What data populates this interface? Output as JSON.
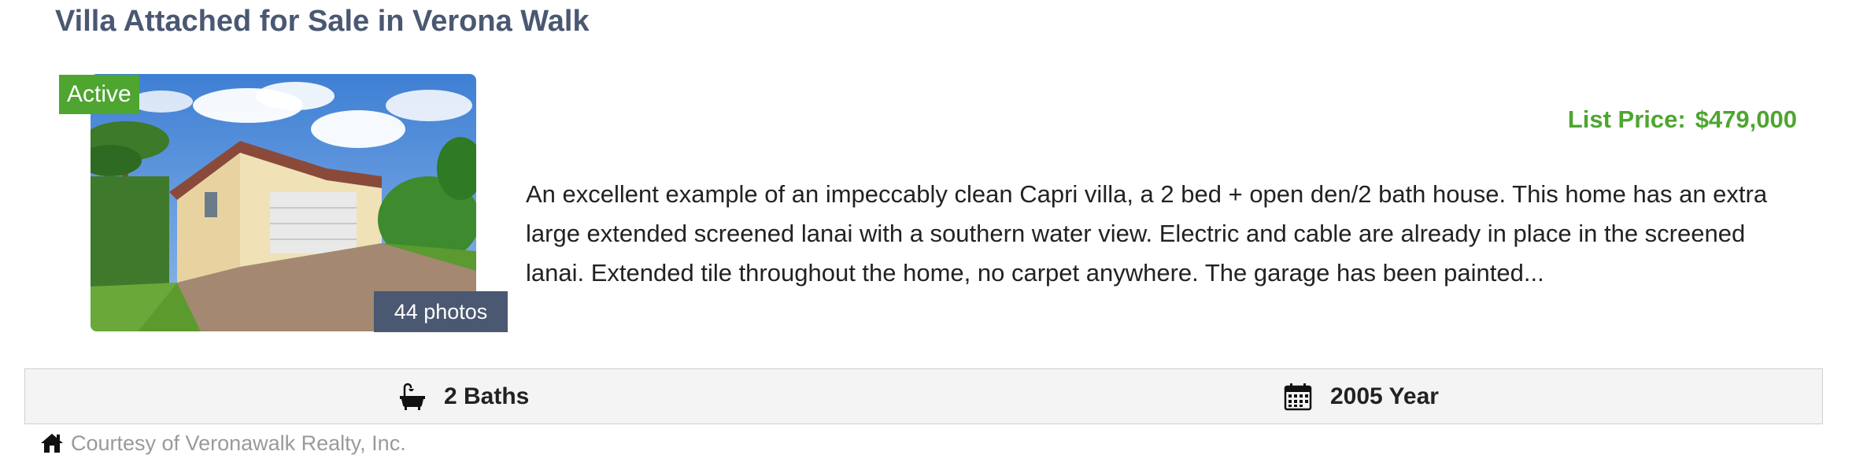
{
  "listing": {
    "title": "Villa Attached for Sale in Verona Walk",
    "status": "Active",
    "photos_label": "44 photos",
    "price_label": "List Price:",
    "price_value": "$479,000",
    "description": "An excellent example of an impeccably clean Capri villa, a 2 bed + open den/2 bath house. This home has an extra large extended screened lanai with a southern water view. Electric and cable are already in place in the screened lanai. Extended tile throughout the home, no carpet anywhere. The garage has been painted..."
  },
  "stats": {
    "baths": {
      "icon": "bathtub-icon",
      "label": "2 Baths"
    },
    "year": {
      "icon": "calendar-icon",
      "label": "2005 Year"
    }
  },
  "courtesy": {
    "icon": "house-icon",
    "text": "Courtesy of Veronawalk Realty, Inc."
  },
  "colors": {
    "title": "#4a5872",
    "accent_green": "#4ea530",
    "badge_dark": "#4a5872",
    "stats_bg": "#f4f4f4",
    "muted": "#9a9a9a"
  }
}
